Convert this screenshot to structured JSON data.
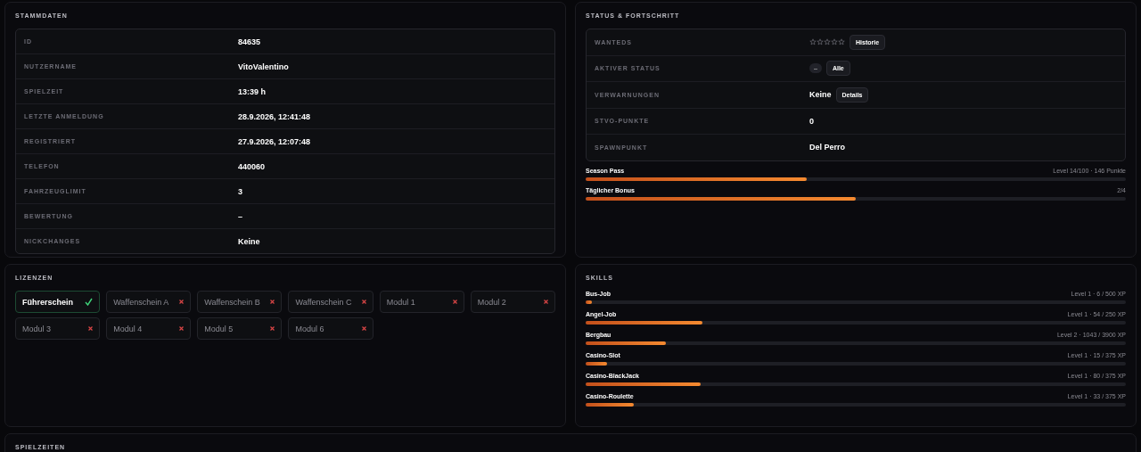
{
  "stammdaten": {
    "title": "STAMMDATEN",
    "rows": [
      {
        "label": "ID",
        "value": "84635"
      },
      {
        "label": "NUTZERNAME",
        "value": "VitoValentino"
      },
      {
        "label": "SPIELZEIT",
        "value": "13:39 h"
      },
      {
        "label": "LETZTE ANMELDUNG",
        "value": "28.9.2026, 12:41:48"
      },
      {
        "label": "REGISTRIERT",
        "value": "27.9.2026, 12:07:48"
      },
      {
        "label": "TELEFON",
        "value": "440060"
      },
      {
        "label": "FAHRZEUGLIMIT",
        "value": "3"
      },
      {
        "label": "BEWERTUNG",
        "value": "–"
      },
      {
        "label": "NICKCHANGES",
        "value": "Keine"
      }
    ]
  },
  "status": {
    "title": "STATUS & FORTSCHRITT",
    "rows": [
      {
        "kind": "stars",
        "label": "WANTEDS",
        "stars": 0,
        "button": "Historie"
      },
      {
        "kind": "chip",
        "label": "AKTIVER STATUS",
        "value": "–",
        "button": "Alle"
      },
      {
        "kind": "text",
        "label": "VERWARNUNGEN",
        "value": "Keine",
        "button": "Details"
      },
      {
        "kind": "text",
        "label": "STVO-PUNKTE",
        "value": "0"
      },
      {
        "kind": "text",
        "label": "SPAWNPUNKT",
        "value": "Del Perro"
      }
    ],
    "progress": [
      {
        "name": "Season Pass",
        "reading": "Level 14/100 · 146 Punkte",
        "level": 0.41
      },
      {
        "name": "Täglicher Bonus",
        "reading": "2/4",
        "level": 0.5
      }
    ]
  },
  "lizenzen": {
    "title": "LIZENZEN",
    "items": [
      {
        "name": "Führerschein",
        "owned": true
      },
      {
        "name": "Waffenschein A",
        "owned": false
      },
      {
        "name": "Waffenschein B",
        "owned": false
      },
      {
        "name": "Waffenschein C",
        "owned": false
      },
      {
        "name": "Modul 1",
        "owned": false
      },
      {
        "name": "Modul 2",
        "owned": false
      },
      {
        "name": "Modul 3",
        "owned": false
      },
      {
        "name": "Modul 4",
        "owned": false
      },
      {
        "name": "Modul 5",
        "owned": false
      },
      {
        "name": "Modul 6",
        "owned": false
      }
    ]
  },
  "skills": {
    "title": "SKILLS",
    "items": [
      {
        "name": "Bus-Job",
        "reading": "Level 1 · 6 / 500 XP",
        "level": 0.012
      },
      {
        "name": "Angel-Job",
        "reading": "Level 1 · 54 / 250 XP",
        "level": 0.216
      },
      {
        "name": "Bergbau",
        "reading": "Level 2 · 1043 / 3900 XP",
        "level": 0.148
      },
      {
        "name": "Casino-Slot",
        "reading": "Level 1 · 15 / 375 XP",
        "level": 0.04
      },
      {
        "name": "Casino-BlackJack",
        "reading": "Level 1 · 80 / 375 XP",
        "level": 0.213
      },
      {
        "name": "Casino-Roulette",
        "reading": "Level 1 · 33 / 375 XP",
        "level": 0.089
      }
    ]
  },
  "spielzeiten": {
    "title": "SPIELZEITEN"
  }
}
